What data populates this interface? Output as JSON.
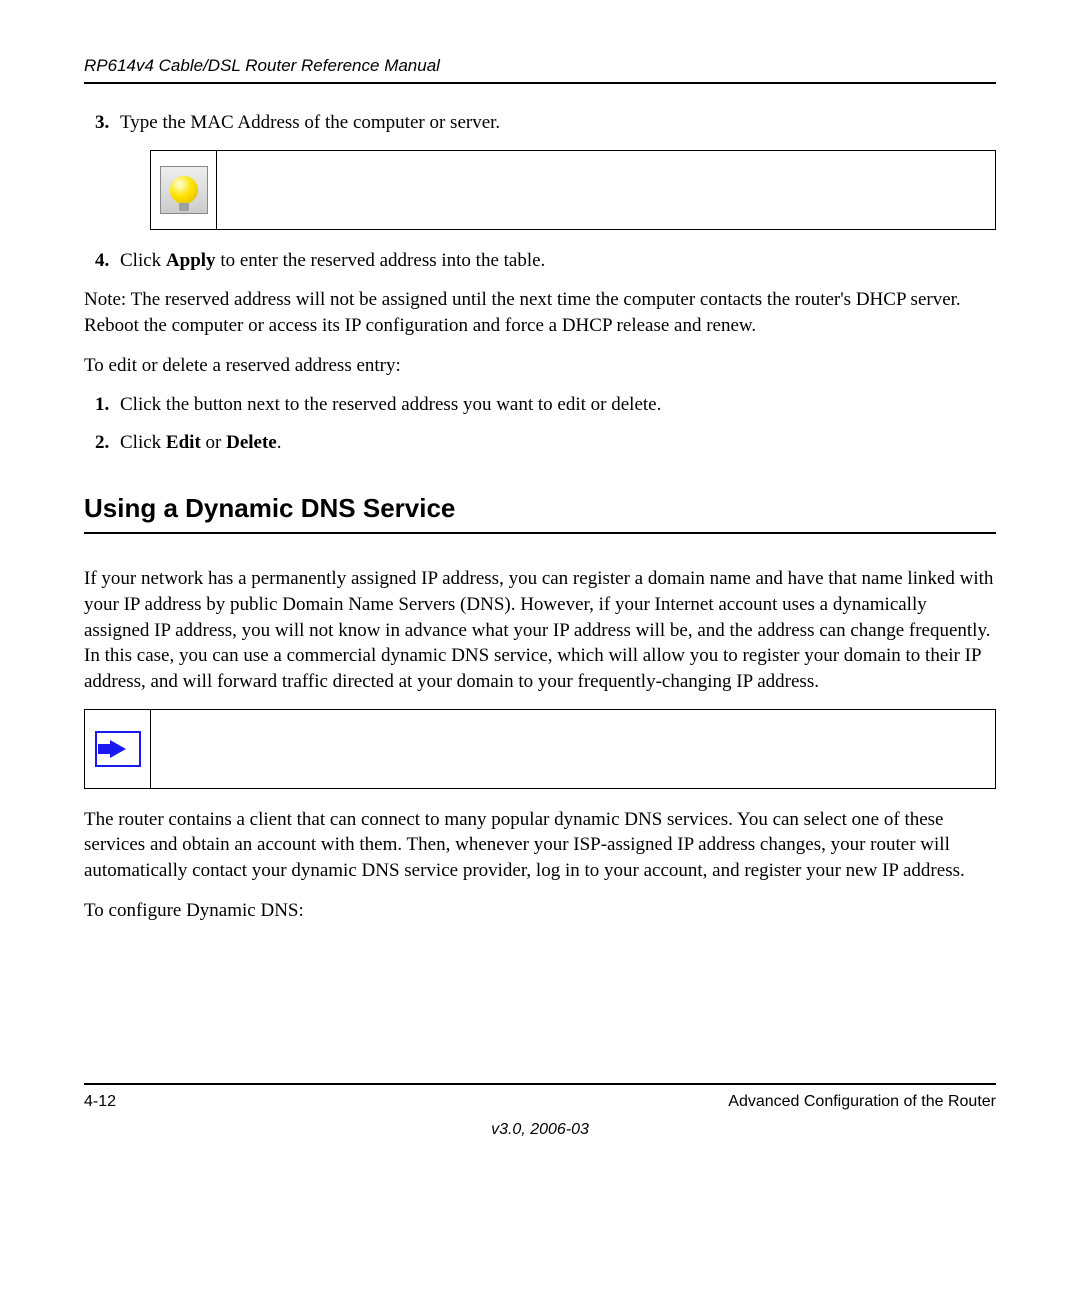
{
  "header": {
    "running_title": "RP614v4 Cable/DSL Router Reference Manual"
  },
  "list1": {
    "start": 3,
    "items": [
      {
        "text": "Type the MAC Address of the computer or server."
      },
      {
        "prefix": "Click ",
        "bold": "Apply",
        "suffix": " to enter the reserved address into the table."
      }
    ]
  },
  "note_text": "Note: The reserved address will not be assigned until the next time the computer contacts the router's DHCP server. Reboot the computer or access its IP configuration and force a DHCP release and renew.",
  "edit_intro": "To edit or delete a reserved address entry:",
  "list2": {
    "start": 1,
    "items": [
      {
        "text": "Click the button next to the reserved address you want to edit or delete."
      },
      {
        "prefix": "Click ",
        "bold": "Edit",
        "mid": " or ",
        "bold2": "Delete",
        "suffix": "."
      }
    ]
  },
  "section_heading": "Using a Dynamic DNS Service",
  "ddns_para1": "If your network has a permanently assigned IP address, you can register a domain name and have that name linked with your IP address by public Domain Name Servers (DNS). However, if your Internet account uses a dynamically assigned IP address, you will not know in advance what your IP address will be, and the address can change frequently. In this case, you can use a commercial dynamic DNS service, which will allow you to register your domain to their IP address, and will forward traffic directed at your domain to your frequently-changing IP address.",
  "ddns_para2": "The router contains a client that can connect to many popular dynamic DNS services. You can select one of these services and obtain an account with them. Then, whenever your ISP-assigned IP address changes, your router will automatically contact your dynamic DNS service provider, log in to your account, and register your new IP address.",
  "ddns_config_intro": "To configure Dynamic DNS:",
  "footer": {
    "page_number": "4-12",
    "section_name": "Advanced Configuration of the Router",
    "version": "v3.0, 2006-03"
  }
}
